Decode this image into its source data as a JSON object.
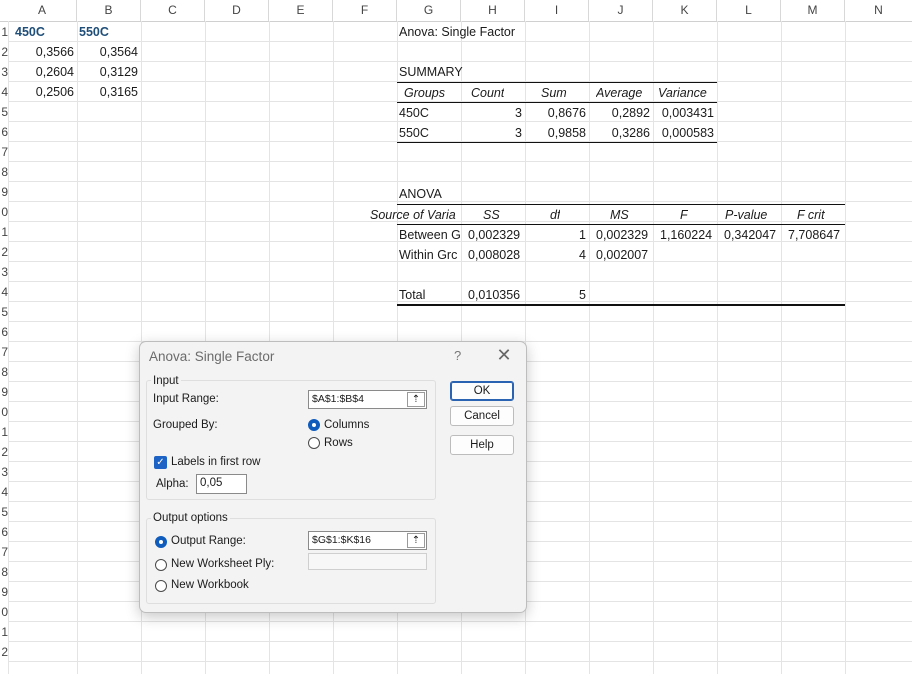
{
  "columns": [
    "A",
    "B",
    "C",
    "D",
    "E",
    "F",
    "G",
    "H",
    "I",
    "J",
    "K",
    "L",
    "M",
    "N"
  ],
  "rows": [
    "1",
    "2",
    "3",
    "4",
    "5",
    "6",
    "7",
    "8",
    "9",
    "0",
    "1",
    "2",
    "3",
    "4",
    "5",
    "6",
    "7",
    "8",
    "9",
    "0",
    "1",
    "2",
    "3",
    "4",
    "5",
    "6",
    "7",
    "8",
    "9",
    "0",
    "1",
    "2"
  ],
  "data": {
    "a1": "450C",
    "b1": "550C",
    "a2": "0,3566",
    "b2": "0,3564",
    "a3": "0,2604",
    "b3": "0,3129",
    "a4": "0,2506",
    "b4": "0,3165"
  },
  "output": {
    "title": "Anova: Single Factor",
    "summary_label": "SUMMARY",
    "summary_headers": [
      "Groups",
      "Count",
      "Sum",
      "Average",
      "Variance"
    ],
    "summary_rows": [
      [
        "450C",
        "3",
        "0,8676",
        "0,2892",
        "0,003431"
      ],
      [
        "550C",
        "3",
        "0,9858",
        "0,3286",
        "0,000583"
      ]
    ],
    "anova_label": "ANOVA",
    "anova_headers": [
      "Source of Varia",
      "SS",
      "df",
      "MS",
      "F",
      "P-value",
      "F crit"
    ],
    "anova_rows": [
      [
        "Between G",
        "0,002329",
        "1",
        "0,002329",
        "1,160224",
        "0,342047",
        "7,708647"
      ],
      [
        "Within Grc",
        "0,008028",
        "4",
        "0,002007",
        "",
        "",
        ""
      ]
    ],
    "total_row": [
      "Total",
      "0,010356",
      "5"
    ]
  },
  "dialog": {
    "title": "Anova: Single Factor",
    "help_glyph": "?",
    "close_glyph": "✕",
    "input_group": "Input",
    "input_range_label": "Input Range:",
    "input_range_value": "$A$1:$B$4",
    "grouped_by_label": "Grouped By:",
    "columns_option": "Columns",
    "rows_option": "Rows",
    "labels_first_row": "Labels in first row",
    "alpha_label": "Alpha:",
    "alpha_value": "0,05",
    "output_group": "Output options",
    "output_range_label": "Output Range:",
    "output_range_value": "$G$1:$K$16",
    "new_ply_label": "New Worksheet Ply:",
    "new_workbook_label": "New Workbook",
    "ok_label": "OK",
    "cancel_label": "Cancel",
    "help_label": "Help",
    "collapse_glyph": "⇡"
  },
  "colors": {
    "header_text": "#1f4e79",
    "accent": "#0f5cbd"
  }
}
